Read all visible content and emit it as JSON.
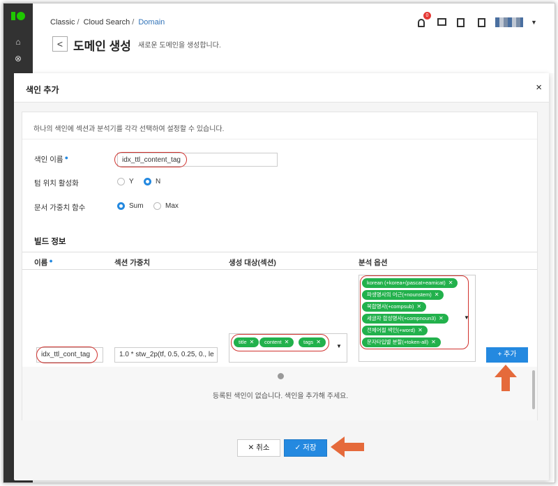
{
  "header": {
    "breadcrumb": [
      "Classic",
      "Cloud Search",
      "Domain"
    ],
    "back_symbol": "<",
    "title": "도메인 생성",
    "description": "새로운 도메인을 생성합니다.",
    "notification_count": "0"
  },
  "modal": {
    "title": "색인 추가",
    "close_symbol": "×",
    "info": "하나의 색인에 섹션과 분석기를 각각 선택하여 설정할 수 있습니다.",
    "form": {
      "index_name_label": "색인 이름",
      "index_name_value": "idx_ttl_content_tag",
      "term_pos_label": "텀 위치 활성화",
      "term_pos_options": [
        "Y",
        "N"
      ],
      "term_pos_selected": "N",
      "doc_weight_label": "문서 가중치 함수",
      "doc_weight_options": [
        "Sum",
        "Max"
      ],
      "doc_weight_selected": "Sum"
    },
    "build": {
      "title": "빌드 정보",
      "columns": [
        "이름",
        "섹션 가중치",
        "생성 대상(섹션)",
        "분석 옵션"
      ],
      "name_value": "idx_ttl_cont_tag",
      "weight_value": "1.0 * stw_2p(tf, 0.5, 0.25, 0., le",
      "sections": [
        "title",
        "content",
        "tags"
      ],
      "analyzers": [
        "korean (+korea+(pascat+eamicat)",
        "파생명사의 어근(+nounstem)",
        "복합명사(+compsub)",
        "세글자 합성명사(+compnoun3)",
        "전체어절 색인(+word)",
        "문자타입별 분할(+token-all)"
      ],
      "add_label": "+ 추가"
    },
    "empty_message": "등록된 색인이 없습니다. 색인을 추가해 주세요.",
    "cancel_label": "✕ 취소",
    "save_label": "✓ 저장"
  },
  "colors": {
    "primary": "#2489e0",
    "tag_green": "#22b14c",
    "annotation_red": "#d0312d",
    "arrow_orange": "#e56a3b",
    "sidebar": "#323232"
  }
}
